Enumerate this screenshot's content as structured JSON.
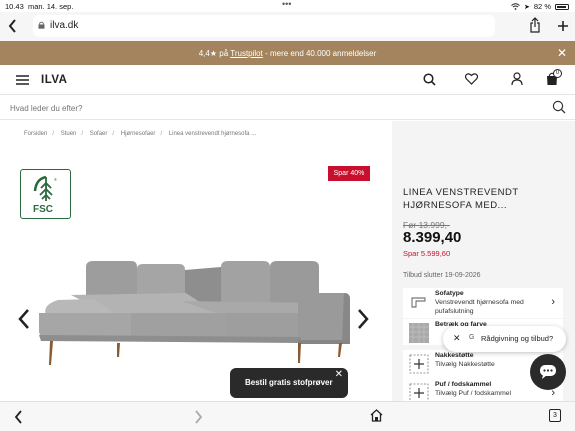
{
  "status_bar": {
    "time": "10.43",
    "date": "man. 14. sep.",
    "battery": "82 %"
  },
  "browser": {
    "url": "ilva.dk"
  },
  "banner": {
    "rating": "4,4",
    "star": "★",
    "on": "på",
    "trustpilot": "Trustpilot",
    "rest": "- mere end 40.000 anmeldelser",
    "close": "✕"
  },
  "header": {
    "logo": "ILVA",
    "cart_count": "0"
  },
  "search": {
    "placeholder": "Hvad leder du efter?"
  },
  "breadcrumbs": [
    "Forsiden",
    "Stuen",
    "Sofaer",
    "Hjørnesofaer",
    "Linea venstrevendt hjørnesofa ..."
  ],
  "product": {
    "badge": "Spar 40%",
    "fsc_label": "FSC",
    "title_line1": "LINEA VENSTREVENDT",
    "title_line2": "HJØRNESOFA MED...",
    "price_old": "Før 13.999,-",
    "price": "8.399,40",
    "price_save": "Spar 5.599,60",
    "offer_end": "Tilbud slutter 19-09-2026"
  },
  "options": [
    {
      "heading": "Sofatype",
      "desc": "Venstrevendt hjørnesofa med pufafslutning",
      "icon": "sofa-type-icon"
    },
    {
      "heading": "Betræk og farve",
      "desc": "",
      "icon": "fabric-swatch-icon"
    },
    {
      "heading": "Nakkestøtte",
      "desc": "Tilvælg Nakkestøtte",
      "icon": "plus-icon"
    },
    {
      "heading": "Puf / fodskammel",
      "desc": "Tilvælg Puf / fodskammel",
      "icon": "plus-icon"
    }
  ],
  "cta": {
    "label": "Bestil gratis stofprøver",
    "close": "✕"
  },
  "chat": {
    "close": "✕",
    "g": "G",
    "label": "Rådgivning og tilbud?"
  },
  "bottom_bar": {
    "tabs_count": "3"
  },
  "colors": {
    "banner": "#a4845e",
    "sale_red": "#c8102e",
    "dark": "#2a2a2a",
    "fsc_green": "#2b6a3e"
  }
}
